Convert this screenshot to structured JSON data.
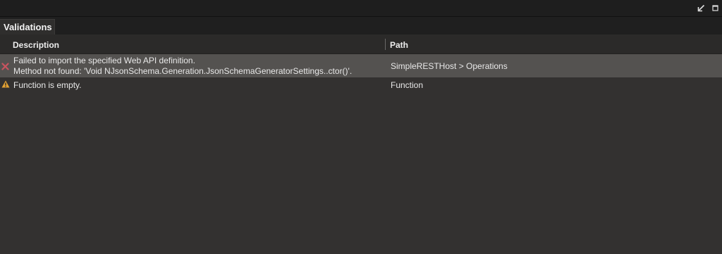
{
  "window": {
    "restore_icon": "arrow-down-left-icon",
    "maximize_icon": "maximize-icon"
  },
  "tabs": [
    {
      "label": "Validations",
      "active": true
    }
  ],
  "table": {
    "columns": [
      "Description",
      "Path"
    ],
    "rows": [
      {
        "severity": "error",
        "icon": "error-x-icon",
        "description_lines": [
          "Failed to import the specified Web API definition.",
          "Method not found: 'Void NJsonSchema.Generation.JsonSchemaGeneratorSettings..ctor()'."
        ],
        "path": "SimpleRESTHost > Operations",
        "selected": true
      },
      {
        "severity": "warning",
        "icon": "warning-triangle-icon",
        "description_lines": [
          "Function is empty."
        ],
        "path": "Function",
        "selected": false
      }
    ]
  },
  "colors": {
    "error": "#c8545f",
    "warning": "#e3a233",
    "selected_row": "#545250",
    "background": "#323130"
  }
}
